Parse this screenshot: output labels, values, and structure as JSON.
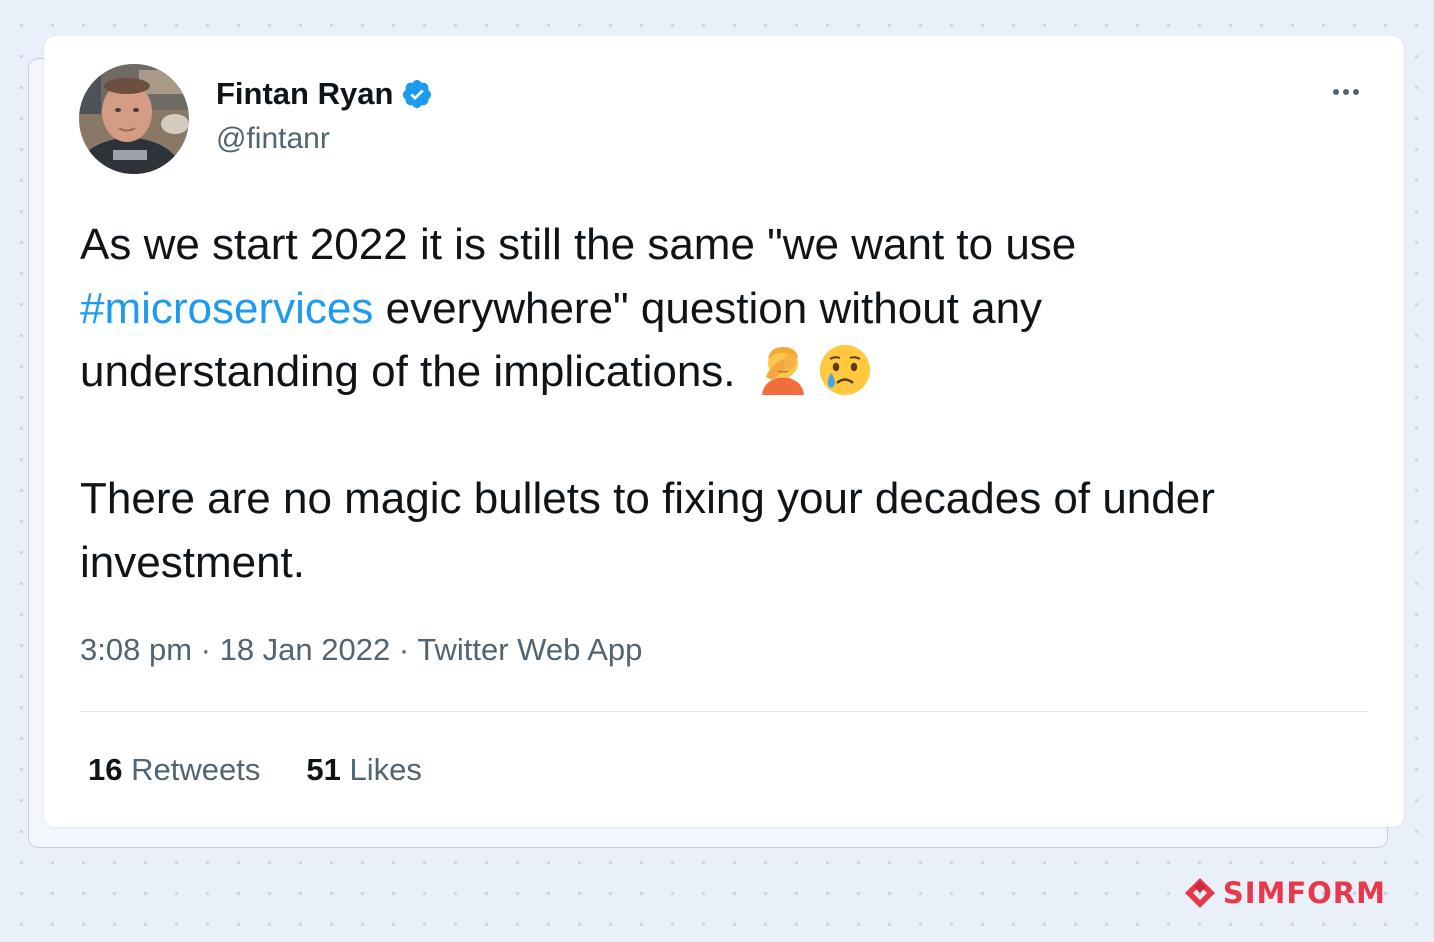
{
  "tweet": {
    "author": {
      "name": "Fintan Ryan",
      "handle": "@fintanr",
      "verified": true
    },
    "text": {
      "line1": "As we start 2022 it is still the same \"we want to use",
      "hashtag": "#microservices",
      "line2_rest": " everywhere\" question without any",
      "line3": "understanding of the implications.",
      "emojis": [
        "facepalm-emoji",
        "crying-face-emoji"
      ],
      "paragraph2": "There are no magic bullets to fixing your decades of under investment."
    },
    "meta": {
      "time": "3:08 pm",
      "date": "18 Jan 2022",
      "separator": " · ",
      "source": "Twitter Web App"
    },
    "stats": {
      "retweets_count": "16",
      "retweets_label": "Retweets",
      "likes_count": "51",
      "likes_label": "Likes"
    }
  },
  "more_menu_icon": "more-horizontal-icon",
  "brand": {
    "name": "SIMFORM",
    "color": "#e8394a"
  },
  "colors": {
    "hashtag": "#1d9bf0",
    "verified": "#1d9bf0",
    "text": "#0f1419",
    "secondary": "#536471",
    "background": "#eaf0fa"
  }
}
